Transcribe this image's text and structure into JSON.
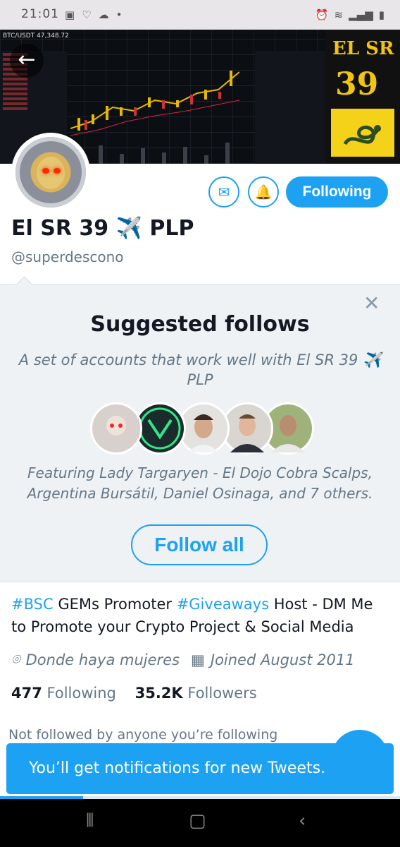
{
  "status_bar": {
    "time": "21:01",
    "left_icons": [
      "image-icon",
      "heart-icon",
      "cloud-icon",
      "dot-icon"
    ],
    "right_icons": [
      "alarm-icon",
      "wifi-icon",
      "signal-icon",
      "battery-icon"
    ]
  },
  "banner": {
    "pair": "BTC/USDT",
    "price": "47,348.72",
    "logo_line1": "EL SR",
    "logo_line2": "39"
  },
  "header": {
    "message_icon": "mail-icon",
    "notify_icon": "bell-check-icon",
    "follow_button": "Following"
  },
  "profile": {
    "name": "El SR 39 ✈️ PLP",
    "handle": "@superdescono",
    "bio_parts": [
      {
        "text": "#BSC",
        "hashtag": true
      },
      {
        "text": " GEMs Promoter ",
        "hashtag": false
      },
      {
        "text": "#Giveaways",
        "hashtag": true
      },
      {
        "text": " Host -   DM Me to Promote your Crypto Project & Social Media",
        "hashtag": false
      }
    ],
    "location": "Donde haya mujeres",
    "joined": "Joined August 2011",
    "following_count": "477",
    "following_label": "Following",
    "followers_count": "35.2K",
    "followers_label": "Followers",
    "not_followed": "Not followed by anyone you’re following"
  },
  "suggested": {
    "title": "Suggested follows",
    "description": "A set of accounts that work well with El SR 39 ✈️ PLP",
    "featuring": "Featuring Lady Targaryen - El Dojo Cobra Scalps, Argentina Bursátil, Daniel Osinaga, and 7 others.",
    "follow_all": "Follow all",
    "avatar_colors": [
      "#d8d0cc",
      "#1b2a2a",
      "#b89a84",
      "#8e8078",
      "#7b8a6a"
    ]
  },
  "toast": {
    "text": "You’ll get notifications for new Tweets."
  },
  "colors": {
    "accent": "#1da1f2",
    "text": "#141823",
    "muted": "#657786"
  }
}
